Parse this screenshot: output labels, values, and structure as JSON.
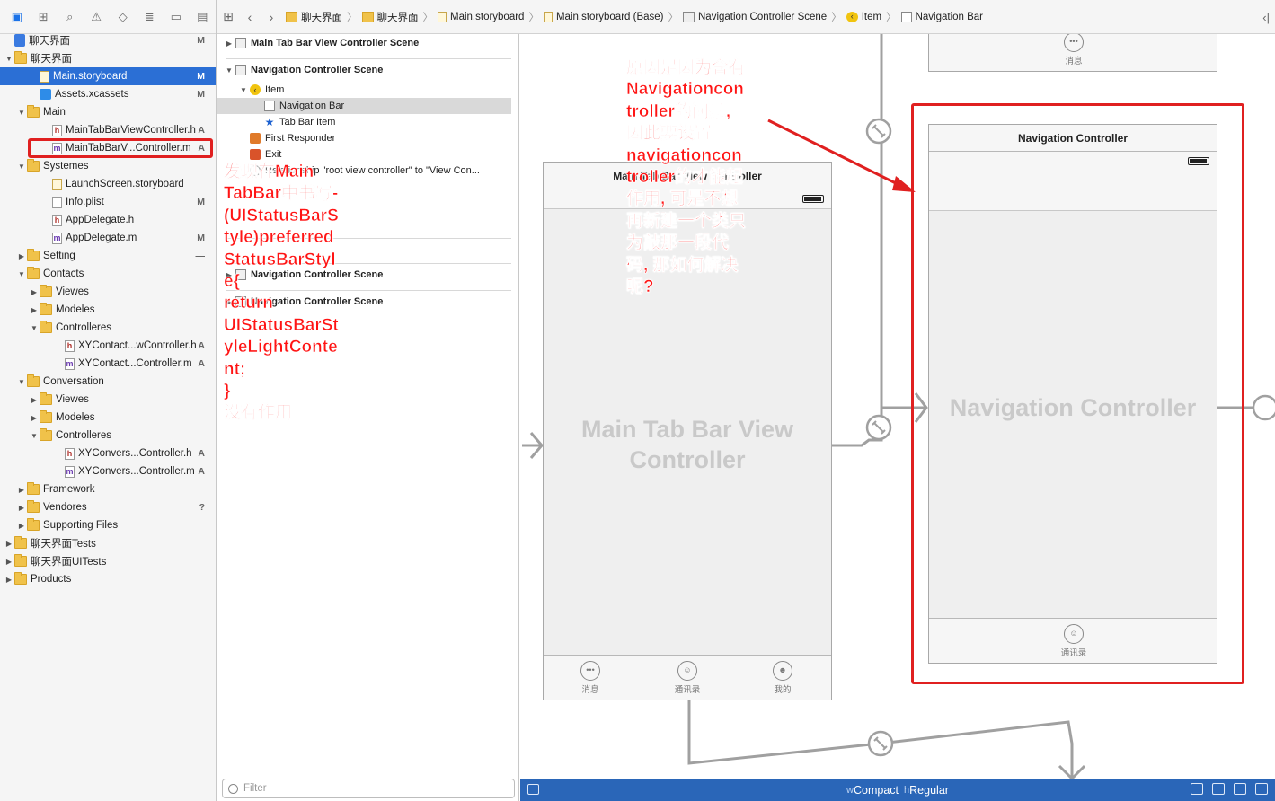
{
  "navigator": {
    "toolbar_icons": [
      "folder-icon",
      "hierarchy-icon",
      "search-icon",
      "warning-icon",
      "test-diamond-icon",
      "debug-icon",
      "breakpoint-icon",
      "report-icon"
    ],
    "tree": [
      {
        "name": "聊天界面",
        "status": "M",
        "indent": 0,
        "disc": "",
        "icon": "proj"
      },
      {
        "name": "聊天界面",
        "status": "",
        "indent": 0,
        "disc": "▼",
        "icon": "folder"
      },
      {
        "name": "Main.storyboard",
        "status": "M",
        "indent": 2,
        "disc": "",
        "icon": "sb",
        "selected": true
      },
      {
        "name": "Assets.xcassets",
        "status": "M",
        "indent": 2,
        "disc": "",
        "icon": "assets"
      },
      {
        "name": "Main",
        "status": "",
        "indent": 1,
        "disc": "▼",
        "icon": "folder"
      },
      {
        "name": "MainTabBarViewController.h",
        "status": "A",
        "indent": 3,
        "disc": "",
        "icon": "h"
      },
      {
        "name": "MainTabBarV...Controller.m",
        "status": "A",
        "indent": 3,
        "disc": "",
        "icon": "m"
      },
      {
        "name": "Systemes",
        "status": "",
        "indent": 1,
        "disc": "▼",
        "icon": "folder"
      },
      {
        "name": "LaunchScreen.storyboard",
        "status": "",
        "indent": 3,
        "disc": "",
        "icon": "sb"
      },
      {
        "name": "Info.plist",
        "status": "M",
        "indent": 3,
        "disc": "",
        "icon": "plist"
      },
      {
        "name": "AppDelegate.h",
        "status": "",
        "indent": 3,
        "disc": "",
        "icon": "h"
      },
      {
        "name": "AppDelegate.m",
        "status": "M",
        "indent": 3,
        "disc": "",
        "icon": "m"
      },
      {
        "name": "Setting",
        "status": "—",
        "indent": 1,
        "disc": "▶",
        "icon": "folder"
      },
      {
        "name": "Contacts",
        "status": "",
        "indent": 1,
        "disc": "▼",
        "icon": "folder"
      },
      {
        "name": "Viewes",
        "status": "",
        "indent": 2,
        "disc": "▶",
        "icon": "folder"
      },
      {
        "name": "Modeles",
        "status": "",
        "indent": 2,
        "disc": "▶",
        "icon": "folder"
      },
      {
        "name": "Controlleres",
        "status": "",
        "indent": 2,
        "disc": "▼",
        "icon": "folder"
      },
      {
        "name": "XYContact...wController.h",
        "status": "A",
        "indent": 4,
        "disc": "",
        "icon": "h"
      },
      {
        "name": "XYContact...Controller.m",
        "status": "A",
        "indent": 4,
        "disc": "",
        "icon": "m"
      },
      {
        "name": "Conversation",
        "status": "",
        "indent": 1,
        "disc": "▼",
        "icon": "folder"
      },
      {
        "name": "Viewes",
        "status": "",
        "indent": 2,
        "disc": "▶",
        "icon": "folder"
      },
      {
        "name": "Modeles",
        "status": "",
        "indent": 2,
        "disc": "▶",
        "icon": "folder"
      },
      {
        "name": "Controlleres",
        "status": "",
        "indent": 2,
        "disc": "▼",
        "icon": "folder"
      },
      {
        "name": "XYConvers...Controller.h",
        "status": "A",
        "indent": 4,
        "disc": "",
        "icon": "h"
      },
      {
        "name": "XYConvers...Controller.m",
        "status": "A",
        "indent": 4,
        "disc": "",
        "icon": "m"
      },
      {
        "name": "Framework",
        "status": "",
        "indent": 1,
        "disc": "▶",
        "icon": "folder"
      },
      {
        "name": "Vendores",
        "status": "?",
        "indent": 1,
        "disc": "▶",
        "icon": "folder"
      },
      {
        "name": "Supporting Files",
        "status": "",
        "indent": 1,
        "disc": "▶",
        "icon": "folder"
      },
      {
        "name": "聊天界面Tests",
        "status": "",
        "indent": 0,
        "disc": "▶",
        "icon": "folder"
      },
      {
        "name": "聊天界面UITests",
        "status": "",
        "indent": 0,
        "disc": "▶",
        "icon": "folder"
      },
      {
        "name": "Products",
        "status": "",
        "indent": 0,
        "disc": "▶",
        "icon": "folder"
      }
    ]
  },
  "jumpbar": {
    "crumbs": [
      {
        "label": "聊天界面",
        "icon": "folder"
      },
      {
        "label": "聊天界面",
        "icon": "folder"
      },
      {
        "label": "Main.storyboard",
        "icon": "sb"
      },
      {
        "label": "Main.storyboard (Base)",
        "icon": "sb"
      },
      {
        "label": "Navigation Controller Scene",
        "icon": "scene"
      },
      {
        "label": "Item",
        "icon": "item"
      },
      {
        "label": "Navigation Bar",
        "icon": "navbar"
      }
    ]
  },
  "outline": {
    "rows": [
      {
        "label": "Main Tab Bar View Controller Scene",
        "bold": true,
        "disc": "▶",
        "icon": "scene",
        "indent": 0
      },
      {
        "label": "Navigation Controller Scene",
        "bold": true,
        "disc": "▼",
        "icon": "scene",
        "indent": 0
      },
      {
        "label": "Item",
        "bold": false,
        "disc": "▼",
        "icon": "item",
        "indent": 1
      },
      {
        "label": "Navigation Bar",
        "bold": false,
        "disc": "",
        "icon": "navbar",
        "indent": 2,
        "selected": true
      },
      {
        "label": "Tab Bar Item",
        "bold": false,
        "disc": "",
        "icon": "star",
        "indent": 2
      },
      {
        "label": "First Responder",
        "bold": false,
        "disc": "",
        "icon": "cube",
        "indent": 1
      },
      {
        "label": "Exit",
        "bold": false,
        "disc": "",
        "icon": "exit",
        "indent": 1
      },
      {
        "label": "Relationship \"root view controller\" to \"View Con...",
        "bold": false,
        "disc": "",
        "icon": "",
        "indent": 1
      },
      {
        "label": "Navigation Controller Scene",
        "bold": true,
        "disc": "▶",
        "icon": "scene",
        "indent": 0
      },
      {
        "label": "Navigation Controller Scene",
        "bold": true,
        "disc": "▶",
        "icon": "scene",
        "indent": 0
      }
    ],
    "filter_placeholder": "Filter"
  },
  "annotations": {
    "left": "发现在Main\nTabBar中书写-\n(UIStatusBarS\ntyle)preferred\nStatusBarStyl\ne{\n  return\nUIStatusBarSt\nyleLightConte\nnt;\n}\n没有作用",
    "right": "原因是因为含有\nNavigationcon\ntroller的问题,\n因此要设置\nnavigationcon\ntroller的才能起\n作用, 可是不想\n再新建一个类只\n为敲那一段代\n码, 那如何解决\n呢?"
  },
  "canvas": {
    "main_scene": {
      "title": "Main Tab Bar View Controller",
      "watermark": "Main Tab Bar View\nController",
      "tabs": [
        {
          "label": "消息",
          "icon": "chat-bubble-icon"
        },
        {
          "label": "通讯录",
          "icon": "contacts-icon"
        },
        {
          "label": "我的",
          "icon": "profile-icon"
        }
      ]
    },
    "nav_scene": {
      "title": "Navigation Controller",
      "watermark": "Navigation Controller",
      "tab": {
        "label": "通讯录",
        "icon": "contacts-icon"
      }
    },
    "top_scene": {
      "tab": {
        "label": "消息",
        "icon": "chat-bubble-icon"
      }
    }
  },
  "size_class": {
    "w_prefix": "w",
    "w_value": "Compact",
    "h_prefix": "h",
    "h_value": "Regular"
  },
  "colors": {
    "selection": "#2b6fd5",
    "annotation": "#ff1414",
    "status_bar": "#2a66b8"
  }
}
